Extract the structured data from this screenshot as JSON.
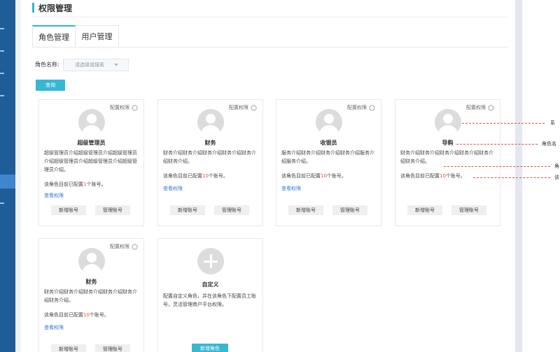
{
  "page_title": "权限管理",
  "tabs": [
    {
      "label": "角色管理",
      "active": true
    },
    {
      "label": "用户管理",
      "active": false
    }
  ],
  "filter": {
    "label": "角色名称:",
    "placeholder": "请选择或搜索"
  },
  "query_button": "查询",
  "config_label": "配置权限",
  "view_perm_label": "查看权限",
  "add_account_label": "新增账号",
  "manage_account_label": "管理账号",
  "cards": [
    {
      "name": "超级管理员",
      "desc": "超级管理员介绍超级管理员介绍超级管理员介绍超级管理员介绍超级管理员介绍超级管理员介绍。",
      "count_prefix": "该角色目前已配置",
      "count": "1",
      "count_suffix": "个账号。"
    },
    {
      "name": "财务",
      "desc": "财务介绍财务介绍财务介绍财务介绍财务介绍财务介绍。",
      "count_prefix": "该角色目前已配置",
      "count": "10",
      "count_suffix": "个账号。"
    },
    {
      "name": "收银员",
      "desc": "服务介绍财务介绍财务介绍财务介绍服务介绍服务介绍。",
      "count_prefix": "该角色目前已配置",
      "count": "10",
      "count_suffix": "个账号。"
    },
    {
      "name": "导购",
      "desc": "财务介绍财务介绍财务介绍财务介绍财务介绍财务介绍。",
      "count_prefix": "该角色目前已配置",
      "count": "10",
      "count_suffix": "个账号。"
    },
    {
      "name": "财务",
      "desc": "财务介绍财务介绍财务介绍财务介绍财务介绍财务介绍。",
      "count_prefix": "该角色目前已配置",
      "count": "10",
      "count_suffix": "个账号。"
    }
  ],
  "custom_card": {
    "name": "自定义",
    "desc": "配置自定义角色，并在该角色下配置员工账号，灵活管理商户平台权限。",
    "button": "新增角色"
  },
  "callouts": [
    "系",
    "角色名",
    "角",
    "该"
  ],
  "colors": {
    "accent": "#36b8d2",
    "link": "#2f7bd1",
    "count_highlight": "#e0523f",
    "sidebar": "#1f5d99"
  }
}
